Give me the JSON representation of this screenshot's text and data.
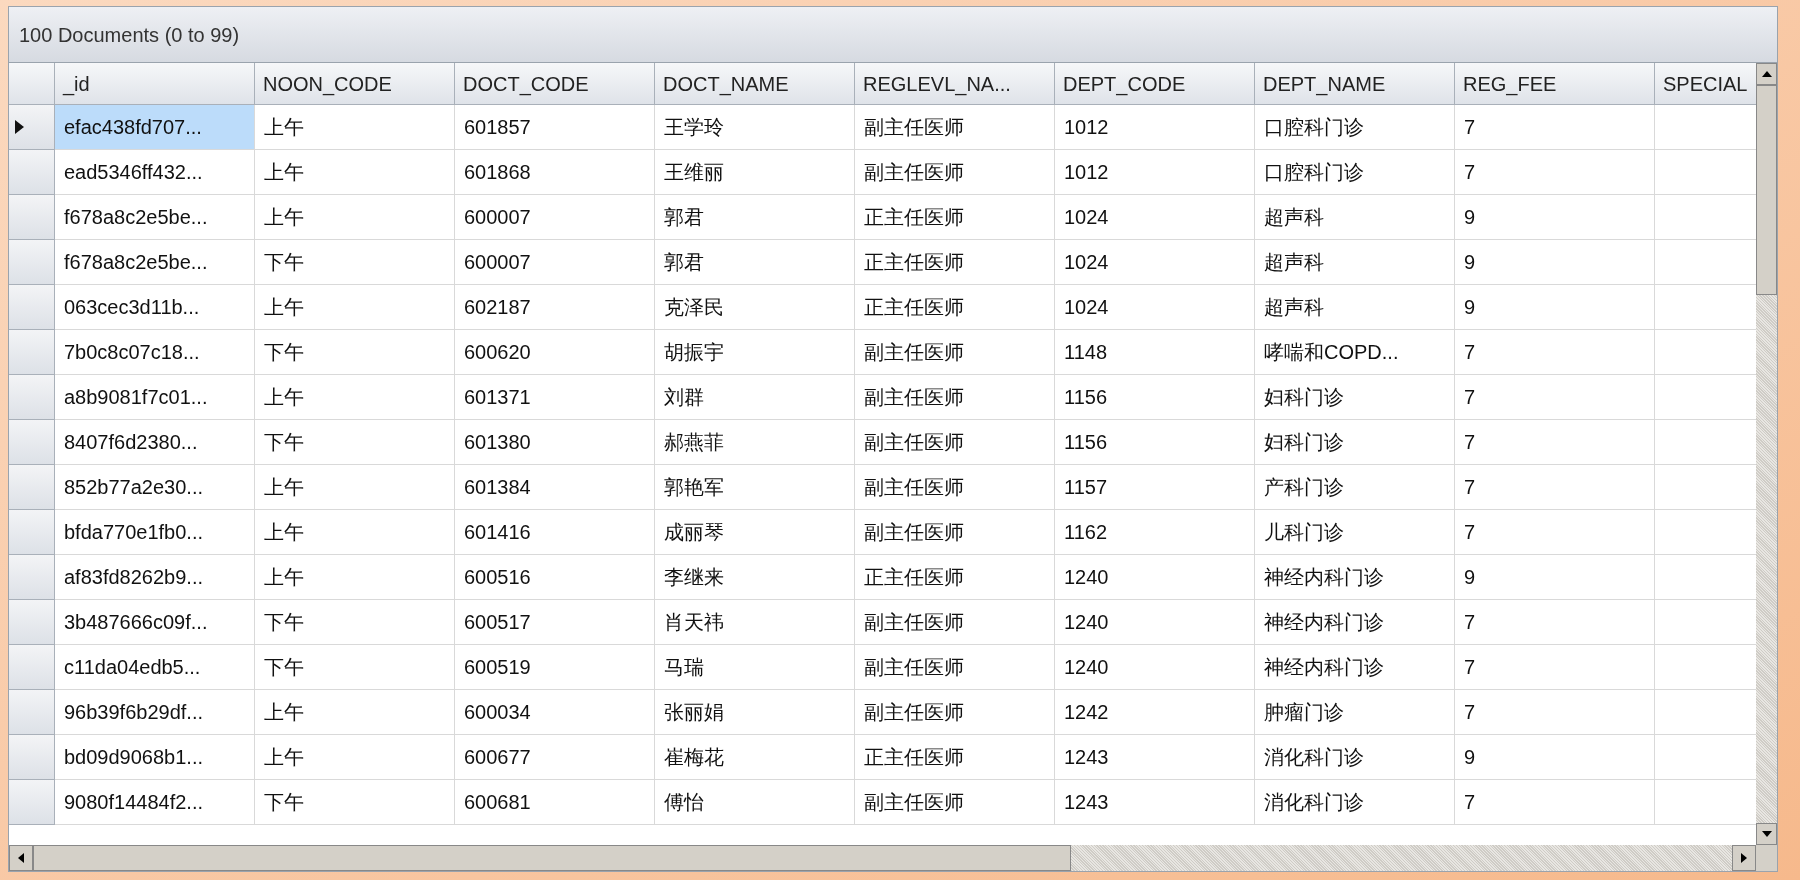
{
  "panel": {
    "title": "100 Documents (0 to 99)"
  },
  "table": {
    "columns": [
      "_id",
      "NOON_CODE",
      "DOCT_CODE",
      "DOCT_NAME",
      "REGLEVL_NA...",
      "DEPT_CODE",
      "DEPT_NAME",
      "REG_FEE",
      "SPECIAL"
    ],
    "rows": [
      {
        "selected": true,
        "cells": [
          "efac438fd707...",
          "上午",
          "601857",
          "王学玲",
          "副主任医师",
          "1012",
          "口腔科门诊",
          "7",
          ""
        ]
      },
      {
        "selected": false,
        "cells": [
          "ead5346ff432...",
          "上午",
          "601868",
          "王维丽",
          "副主任医师",
          "1012",
          "口腔科门诊",
          "7",
          ""
        ]
      },
      {
        "selected": false,
        "cells": [
          "f678a8c2e5be...",
          "上午",
          "600007",
          "郭君",
          "正主任医师",
          "1024",
          "超声科",
          "9",
          ""
        ]
      },
      {
        "selected": false,
        "cells": [
          "f678a8c2e5be...",
          "下午",
          "600007",
          "郭君",
          "正主任医师",
          "1024",
          "超声科",
          "9",
          ""
        ]
      },
      {
        "selected": false,
        "cells": [
          "063cec3d11b...",
          "上午",
          "602187",
          "克泽民",
          "正主任医师",
          "1024",
          "超声科",
          "9",
          ""
        ]
      },
      {
        "selected": false,
        "cells": [
          "7b0c8c07c18...",
          "下午",
          "600620",
          "胡振宇",
          "副主任医师",
          "1148",
          "哮喘和COPD...",
          "7",
          ""
        ]
      },
      {
        "selected": false,
        "cells": [
          "a8b9081f7c01...",
          "上午",
          "601371",
          "刘群",
          "副主任医师",
          "1156",
          "妇科门诊",
          "7",
          ""
        ]
      },
      {
        "selected": false,
        "cells": [
          "8407f6d2380...",
          "下午",
          "601380",
          "郝燕菲",
          "副主任医师",
          "1156",
          "妇科门诊",
          "7",
          ""
        ]
      },
      {
        "selected": false,
        "cells": [
          "852b77a2e30...",
          "上午",
          "601384",
          "郭艳军",
          "副主任医师",
          "1157",
          "产科门诊",
          "7",
          ""
        ]
      },
      {
        "selected": false,
        "cells": [
          "bfda770e1fb0...",
          "上午",
          "601416",
          "成丽琴",
          "副主任医师",
          "1162",
          "儿科门诊",
          "7",
          ""
        ]
      },
      {
        "selected": false,
        "cells": [
          "af83fd8262b9...",
          "上午",
          "600516",
          "李继来",
          "正主任医师",
          "1240",
          "神经内科门诊",
          "9",
          ""
        ]
      },
      {
        "selected": false,
        "cells": [
          "3b487666c09f...",
          "下午",
          "600517",
          "肖天祎",
          "副主任医师",
          "1240",
          "神经内科门诊",
          "7",
          ""
        ]
      },
      {
        "selected": false,
        "cells": [
          "c11da04edb5...",
          "下午",
          "600519",
          "马瑞",
          "副主任医师",
          "1240",
          "神经内科门诊",
          "7",
          ""
        ]
      },
      {
        "selected": false,
        "cells": [
          "96b39f6b29df...",
          "上午",
          "600034",
          "张丽娟",
          "副主任医师",
          "1242",
          "肿瘤门诊",
          "7",
          ""
        ]
      },
      {
        "selected": false,
        "cells": [
          "bd09d9068b1...",
          "上午",
          "600677",
          "崔梅花",
          "正主任医师",
          "1243",
          "消化科门诊",
          "9",
          ""
        ]
      },
      {
        "selected": false,
        "cells": [
          "9080f14484f2...",
          "下午",
          "600681",
          "傅怡",
          "副主任医师",
          "1243",
          "消化科门诊",
          "7",
          ""
        ]
      }
    ]
  }
}
